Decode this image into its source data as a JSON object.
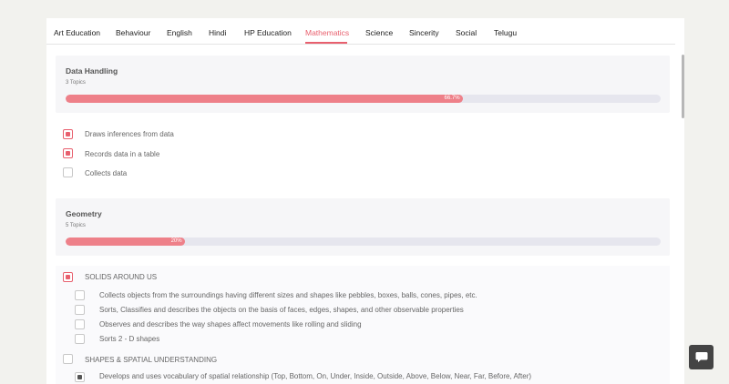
{
  "tabs": [
    {
      "label": "Art Education"
    },
    {
      "label": "Behaviour"
    },
    {
      "label": "English"
    },
    {
      "label": "Hindi"
    },
    {
      "label": "HP Education"
    },
    {
      "label": "Mathematics"
    },
    {
      "label": "Science"
    },
    {
      "label": "Sincerity"
    },
    {
      "label": "Social"
    },
    {
      "label": "Telugu"
    }
  ],
  "active_tab": "Mathematics",
  "accent_color": "#e8606e",
  "sections": [
    {
      "title": "Data Handling",
      "subtitle": "3 Topics",
      "progress": 0.667,
      "progress_label": "66.7%",
      "items": [
        {
          "label": "Draws inferences from data",
          "checked": true
        },
        {
          "label": "Records data in a table",
          "checked": true
        },
        {
          "label": "Collects data",
          "checked": false
        }
      ]
    },
    {
      "title": "Geometry",
      "subtitle": "5 Topics",
      "progress": 0.2,
      "progress_label": "20%",
      "groups": [
        {
          "label": "SOLIDS AROUND US",
          "checked": true,
          "items": [
            {
              "label": "Collects objects from the surroundings having different sizes and shapes like pebbles, boxes, balls, cones, pipes, etc.",
              "checked": false
            },
            {
              "label": "Sorts, Classifies and describes the objects on the basis of faces, edges, shapes, and other observable properties",
              "checked": false
            },
            {
              "label": "Observes and describes the way shapes affect movements like rolling and sliding",
              "checked": false
            },
            {
              "label": "Sorts 2 - D shapes",
              "checked": false
            }
          ]
        },
        {
          "label": "SHAPES & SPATIAL UNDERSTANDING",
          "checked": false,
          "items": [
            {
              "label": "Develops and uses vocabulary of spatial relationship (Top, Bottom, On, Under, Inside, Outside, Above, Below, Near, Far, Before, After)",
              "checked": true
            }
          ]
        }
      ]
    }
  ],
  "chat_icon": "chat-bubble-icon"
}
